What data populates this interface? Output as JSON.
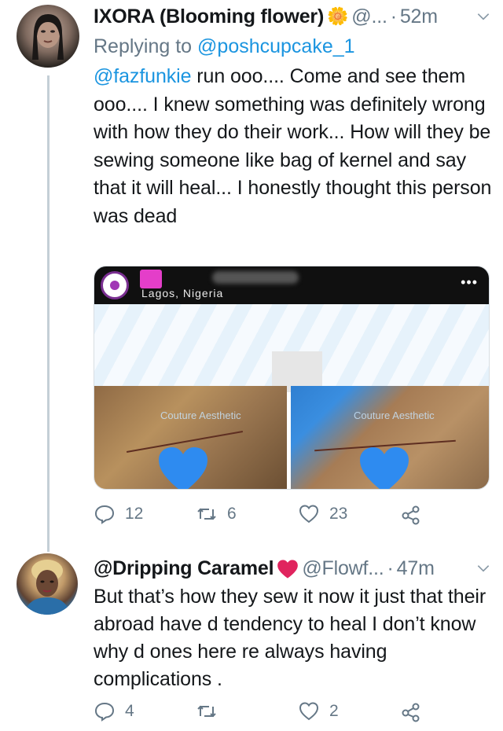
{
  "tweet1": {
    "name": "IXORA (Blooming flower)",
    "name_emoji": "🌼",
    "handle": "@...",
    "dot": "·",
    "time": "52m",
    "replying_prefix": "Replying to",
    "replying_to": "@poshcupcake_1",
    "mention": "@fazfunkie",
    "text": " run ooo.... Come and see them ooo.... I knew something was definitely wrong with how they do their work... How will they be sewing someone like bag of kernel and say that it will heal... I honestly thought this person was dead",
    "media": {
      "location": "Lagos, Nigeria",
      "menu": "•••",
      "watermark1": "Couture Aesthetic",
      "watermark2": "Couture Aesthetic"
    },
    "actions": {
      "reply_count": "12",
      "retweet_count": "6",
      "like_count": "23"
    }
  },
  "tweet2": {
    "name": "@Dripping Caramel",
    "name_emoji": "❤️",
    "handle": "@Flowf...",
    "dot": "·",
    "time": "47m",
    "text": "But that’s how they sew it now it just that their abroad have d tendency to heal I don’t know why d ones here re always having complications .",
    "actions": {
      "reply_count": "4",
      "retweet_count": "",
      "like_count": "2"
    }
  },
  "colors": {
    "accent": "#1b95e0",
    "secondary_text": "#657786",
    "heart_emoji": "#2e8bf0",
    "name_heart": "#e0245e"
  }
}
